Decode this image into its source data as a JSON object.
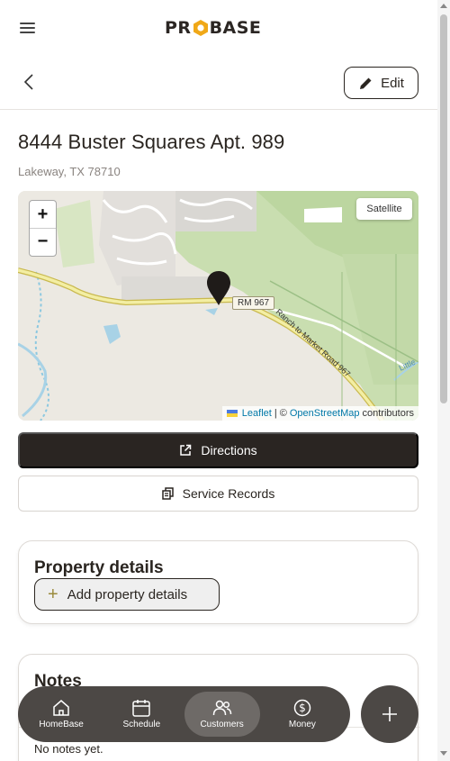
{
  "header": {
    "logo_text_left": "PR",
    "logo_text_right": "BASE"
  },
  "toolbar": {
    "edit_label": "Edit"
  },
  "property": {
    "address": "8444 Buster Squares Apt. 989",
    "city_line": "Lakeway, TX 78710"
  },
  "map": {
    "zoom_in": "+",
    "zoom_out": "−",
    "satellite_label": "Satellite",
    "road_label": "RM 967",
    "road_name": "Ranch to Market Road 967",
    "water_label": "Little",
    "attribution": {
      "leaflet": "Leaflet",
      "sep": "| ©",
      "osm": "OpenStreetMap",
      "contributors": "contributors"
    }
  },
  "actions": {
    "directions_label": "Directions",
    "service_records_label": "Service Records"
  },
  "property_details": {
    "title": "Property details",
    "add_label": "Add property details"
  },
  "notes": {
    "title": "Notes",
    "empty_text": "No notes yet."
  },
  "bottom_nav": {
    "items": [
      {
        "label": "HomeBase",
        "icon": "home-icon"
      },
      {
        "label": "Schedule",
        "icon": "calendar-icon"
      },
      {
        "label": "Customers",
        "icon": "users-icon",
        "active": true
      },
      {
        "label": "Money",
        "icon": "dollar-icon"
      }
    ],
    "fab_icon": "plus-icon"
  },
  "colors": {
    "dark": "#2a2522",
    "accent": "#f0a818",
    "nav_bg": "#4c4845"
  }
}
